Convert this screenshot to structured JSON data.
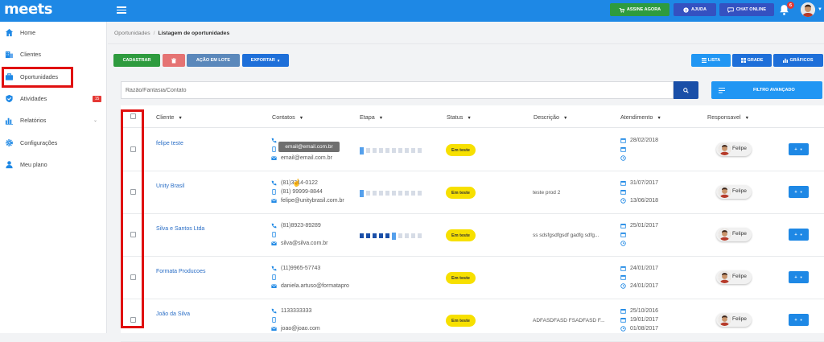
{
  "topbar": {
    "logo": "meets",
    "assine_label": "ASSINE AGORA",
    "ajuda_label": "AJUDA",
    "chat_label": "CHAT ONLINE",
    "notification_count": "6"
  },
  "sidebar": {
    "items": [
      {
        "label": "Home",
        "icon": "home-icon"
      },
      {
        "label": "Clientes",
        "icon": "building-icon"
      },
      {
        "label": "Oportunidades",
        "icon": "briefcase-icon"
      },
      {
        "label": "Atividades",
        "icon": "checkmark-shield-icon",
        "badge": "15"
      },
      {
        "label": "Relatórios",
        "icon": "bar-chart-icon"
      },
      {
        "label": "Configurações",
        "icon": "gear-icon"
      },
      {
        "label": "Meu plano",
        "icon": "person-icon"
      }
    ]
  },
  "breadcrumb": {
    "parent": "Oportunidades",
    "current": "Listagem de oportunidades"
  },
  "actions": {
    "cadastrar": "CADASTRAR",
    "lote": "AÇÃO EM LOTE",
    "exportar": "EXPORTAR"
  },
  "views": {
    "lista": "LISTA",
    "grade": "GRADE",
    "graficos": "GRÁFICOS"
  },
  "search": {
    "placeholder": "Razão/Fantasia/Contato",
    "filtro_label": "FILTRO AVANÇADO"
  },
  "table": {
    "columns": [
      "Cliente",
      "Contatos",
      "Etapa",
      "Status",
      "Descrição",
      "Atendimento",
      "Responsavel"
    ],
    "rows": [
      {
        "cliente": "felipe teste",
        "phone1": "",
        "phone2": "",
        "email": "email@email.com.br",
        "etapa": {
          "filled": 0,
          "current": 1,
          "total": 10
        },
        "status": "Em teste",
        "descricao": "",
        "date1": "28/02/2018",
        "date2": "",
        "date3": "",
        "responsavel": "Felipe"
      },
      {
        "cliente": "Unity Brasil",
        "phone1": "(81)3314-0122",
        "phone2": "(81) 99999-8844",
        "email": "felipe@unitybrasil.com.br",
        "etapa": {
          "filled": 0,
          "current": 1,
          "total": 10
        },
        "status": "Em teste",
        "descricao": "teste prod 2",
        "date1": "31/07/2017",
        "date2": "",
        "date3": "13/06/2018",
        "responsavel": "Felipe"
      },
      {
        "cliente": "Silva e Santos Ltda",
        "phone1": "(81)8923-89289",
        "phone2": "",
        "email": "silva@silva.com.br",
        "etapa": {
          "filled": 5,
          "current": 6,
          "total": 10
        },
        "status": "Em teste",
        "descricao": "ss sdsfgsdfgsdf gadfg sdfg...",
        "date1": "25/01/2017",
        "date2": "",
        "date3": "",
        "responsavel": "Felipe"
      },
      {
        "cliente": "Formata Producoes",
        "phone1": "(11)9965-57743",
        "phone2": "",
        "email": "daniela.artuso@formatapro",
        "etapa": {
          "filled": 0,
          "current": 0,
          "total": 0
        },
        "status": "Em teste",
        "descricao": "",
        "date1": "24/01/2017",
        "date2": "",
        "date3": "24/01/2017",
        "responsavel": "Felipe"
      },
      {
        "cliente": "João da Silva",
        "phone1": "1133333333",
        "phone2": "",
        "email": "joao@joao.com",
        "etapa": {
          "filled": 0,
          "current": 0,
          "total": 0
        },
        "status": "Em teste",
        "descricao": "ADFASDFASD FSADFASD F...",
        "date1": "25/10/2016",
        "date2": "19/01/2017",
        "date3": "01/08/2017",
        "responsavel": "Felipe"
      }
    ]
  },
  "tooltip": "email@email.com.br",
  "colors": {
    "primary": "#1e88e5",
    "success": "#2e9b3e",
    "status_yellow": "#f7e000",
    "highlight_red": "#e01010"
  }
}
